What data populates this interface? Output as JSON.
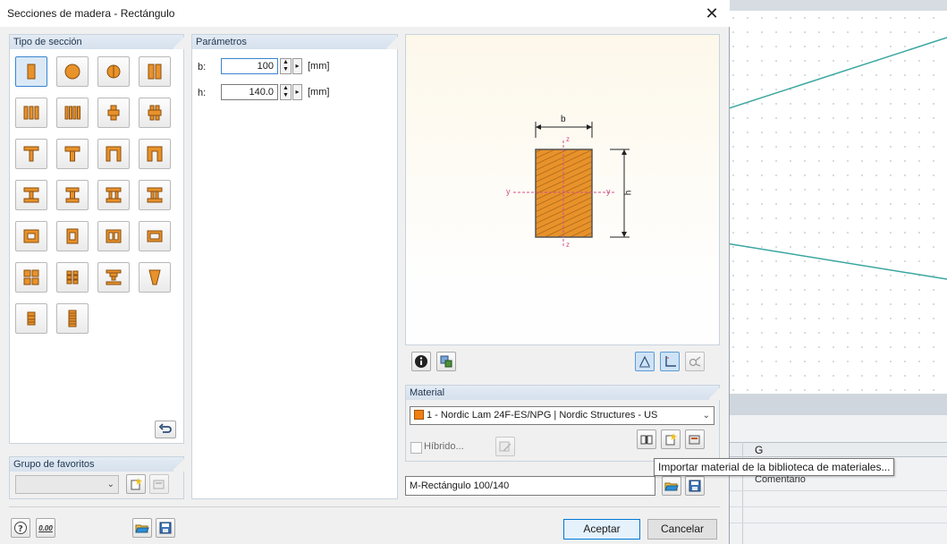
{
  "dialog": {
    "title": "Secciones de madera - Rectángulo",
    "close_glyph": "✕"
  },
  "section_type": {
    "header": "Tipo de sección",
    "selected_index": 0,
    "icons": [
      "rectangle-icon",
      "circle-icon",
      "split-circle-icon",
      "double-rectangle-icon",
      "triple-rectangle-icon",
      "quad-rectangle-icon",
      "cross-rect-icon",
      "double-cross-rect-icon",
      "t-section-icon",
      "t-section-alt-icon",
      "u-section-icon",
      "u-section-alt-icon",
      "i-section-icon",
      "i-section-alt-icon",
      "double-i-section-icon",
      "double-i-section-alt-icon",
      "box-section-icon",
      "box-section-alt-icon",
      "double-box-icon",
      "double-box-alt-icon",
      "grid-four-icon",
      "grid-dots-icon",
      "i-compound-icon",
      "tapered-icon",
      "stacked-beam-icon",
      "stacked-beam-tall-icon"
    ],
    "reset_button_icon": "undo-icon"
  },
  "parameters": {
    "header": "Parámetros",
    "rows": [
      {
        "label": "b:",
        "value": "100",
        "unit": "[mm]"
      },
      {
        "label": "h:",
        "value": "140.0",
        "unit": "[mm]"
      }
    ]
  },
  "preview": {
    "dim_b": "b",
    "dim_h": "h",
    "axis_y_left": "y",
    "axis_y_right": "y",
    "axis_z_top": "z",
    "axis_z_bottom": "z",
    "colors": {
      "section_fill": "#e8922a",
      "hatch": "#9a5a14",
      "axis": "#d0508a"
    }
  },
  "material": {
    "header": "Material",
    "color": "#f07f12",
    "selected": "1 - Nordic Lam 24F-ES/NPG | Nordic Structures - US",
    "hybrid_label": "Híbrido...",
    "tooltip": "Importar material de la biblioteca de materiales..."
  },
  "favorites": {
    "header": "Grupo de favoritos"
  },
  "section_name": {
    "value": "M-Rectángulo 100/140"
  },
  "footer": {
    "ok_label": "Aceptar",
    "cancel_label": "Cancelar",
    "units_label": "0.00"
  },
  "background_app": {
    "column_header": "G",
    "cell_text": "Comentario"
  }
}
